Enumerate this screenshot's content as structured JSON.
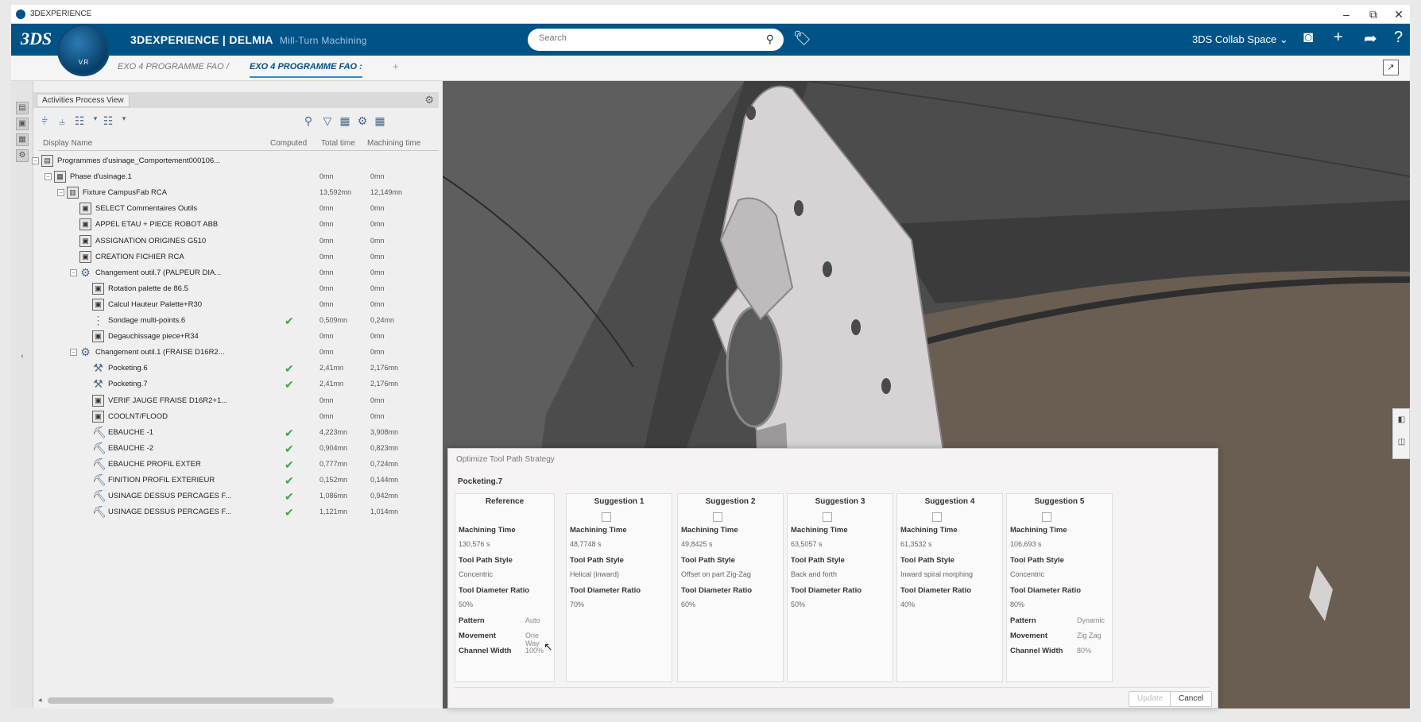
{
  "window": {
    "title": "3DEXPERIENCE",
    "min": "–",
    "restore": "⧉",
    "close": "✕"
  },
  "topbar": {
    "ds_logo": "3DS",
    "brand_bold": "3DEXPERIENCE | DELMIA",
    "brand_app": "Mill-Turn Machining",
    "compass_version": "V.R",
    "search_placeholder": "Search",
    "collab_space": "3DS Collab Space ⌄",
    "colors": {
      "bar": "#005386"
    }
  },
  "tabs": [
    {
      "label": "EXO 4 PROGRAMME FAO /"
    },
    {
      "label": "EXO 4 PROGRAMME FAO :"
    }
  ],
  "panel": {
    "tab_label": "Activities Process View",
    "columns": [
      "Display Name",
      "Computed",
      "Total time",
      "Machining time"
    ],
    "rows": [
      {
        "name": "Programmes d'usinage_Comportement000106...",
        "computed": false,
        "total": "",
        "mach": "",
        "icon": "program-icon"
      },
      {
        "name": "Phase d'usinage.1",
        "computed": false,
        "total": "0mn",
        "mach": "0mn",
        "icon": "phase-icon"
      },
      {
        "name": "Fixture CampusFab RCA",
        "computed": false,
        "total": "13,592mn",
        "mach": "12,149mn",
        "icon": "fixture-icon"
      },
      {
        "name": "SELECT Commentaires Outils",
        "computed": false,
        "total": "0mn",
        "mach": "0mn",
        "icon": "nc-macro-icon"
      },
      {
        "name": "APPEL ETAU + PIECE ROBOT ABB",
        "computed": false,
        "total": "0mn",
        "mach": "0mn",
        "icon": "nc-macro-icon"
      },
      {
        "name": "ASSIGNATION ORIGINES G510",
        "computed": false,
        "total": "0mn",
        "mach": "0mn",
        "icon": "nc-macro-icon"
      },
      {
        "name": "CREATION FICHIER RCA",
        "computed": false,
        "total": "0mn",
        "mach": "0mn",
        "icon": "nc-macro-icon"
      },
      {
        "name": "Changement outil.7 (PALPEUR DIA...",
        "computed": false,
        "total": "0mn",
        "mach": "0mn",
        "icon": "tool-change-icon"
      },
      {
        "name": "Rotation palette de 86.5",
        "computed": false,
        "total": "0mn",
        "mach": "0mn",
        "icon": "nc-macro-icon"
      },
      {
        "name": "Calcul Hauteur Palette+R30",
        "computed": false,
        "total": "0mn",
        "mach": "0mn",
        "icon": "nc-macro-icon"
      },
      {
        "name": "Sondage multi-points.6",
        "computed": true,
        "total": "0,509mn",
        "mach": "0,24mn",
        "icon": "probing-icon"
      },
      {
        "name": "Degauchissage piece+R34",
        "computed": false,
        "total": "0mn",
        "mach": "0mn",
        "icon": "nc-macro-icon"
      },
      {
        "name": "Changement outil.1 (FRAISE D16R2...",
        "computed": false,
        "total": "0mn",
        "mach": "0mn",
        "icon": "tool-change-icon"
      },
      {
        "name": "Pocketing.6",
        "computed": true,
        "total": "2,41mn",
        "mach": "2,176mn",
        "icon": "pocketing-icon"
      },
      {
        "name": "Pocketing.7",
        "computed": true,
        "total": "2,41mn",
        "mach": "2,176mn",
        "icon": "pocketing-icon"
      },
      {
        "name": "VERIF JAUGE FRAISE D16R2+1...",
        "computed": false,
        "total": "0mn",
        "mach": "0mn",
        "icon": "nc-macro-icon"
      },
      {
        "name": "COOLNT/FLOOD",
        "computed": false,
        "total": "0mn",
        "mach": "0mn",
        "icon": "nc-macro-icon"
      },
      {
        "name": "EBAUCHE -1",
        "computed": true,
        "total": "4,223mn",
        "mach": "3,908mn",
        "icon": "roughing-icon"
      },
      {
        "name": "EBAUCHE -2",
        "computed": true,
        "total": "0,904mn",
        "mach": "0,823mn",
        "icon": "roughing-icon"
      },
      {
        "name": "EBAUCHE PROFIL EXTER",
        "computed": true,
        "total": "0,777mn",
        "mach": "0,724mn",
        "icon": "roughing-icon"
      },
      {
        "name": "FINITION PROFIL EXTERIEUR",
        "computed": true,
        "total": "0,152mn",
        "mach": "0,144mn",
        "icon": "finishing-icon"
      },
      {
        "name": "USINAGE DESSUS PERCAGES F...",
        "computed": true,
        "total": "1,086mn",
        "mach": "0,942mn",
        "icon": "drilling-icon"
      },
      {
        "name": "USINAGE DESSUS PERCAGES F...",
        "computed": true,
        "total": "1,121mn",
        "mach": "1,014mn",
        "icon": "drilling-icon"
      }
    ]
  },
  "dialog": {
    "title": "Optimize Tool Path Strategy",
    "operation": "Pocketing.7",
    "labels": {
      "machining_time": "Machining Time",
      "tool_path_style": "Tool Path Style",
      "tool_diameter_ratio": "Tool Diameter Ratio",
      "pattern": "Pattern",
      "movement": "Movement",
      "channel_width": "Channel Width"
    },
    "columns": [
      {
        "header": "Reference",
        "time": "130,576 s",
        "style": "Concentric",
        "ratio": "50%",
        "pattern": "Auto",
        "movement": "One Way",
        "channel": "100%"
      },
      {
        "header": "Suggestion 1",
        "time": "48,7748 s",
        "style": "Helical (inward)",
        "ratio": "70%"
      },
      {
        "header": "Suggestion 2",
        "time": "49,8425 s",
        "style": "Offset on part Zig-Zag",
        "ratio": "60%"
      },
      {
        "header": "Suggestion 3",
        "time": "63,5057 s",
        "style": "Back and forth",
        "ratio": "50%"
      },
      {
        "header": "Suggestion 4",
        "time": "61,3532 s",
        "style": "Inward spiral morphing",
        "ratio": "40%"
      },
      {
        "header": "Suggestion 5",
        "time": "106,693 s",
        "style": "Concentric",
        "ratio": "80%",
        "pattern": "Dynamic",
        "movement": "Zig Zag",
        "channel": "80%"
      }
    ],
    "update_label": "Update",
    "cancel_label": "Cancel"
  }
}
